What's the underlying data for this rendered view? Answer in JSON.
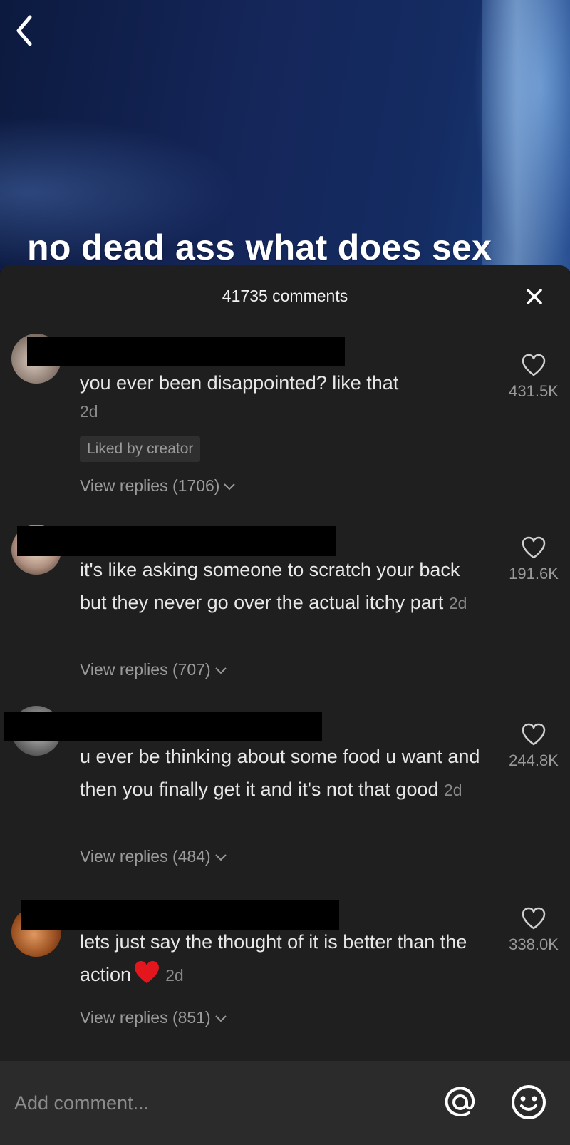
{
  "video": {
    "caption": "no dead ass what does sex"
  },
  "icons": {
    "back": "chevron-left-icon",
    "close": "close-icon",
    "like": "heart-outline-icon",
    "expand": "chevron-down-icon",
    "mention": "at-sign-icon",
    "emoji": "smiley-icon",
    "heart_emoji": "red-heart-emoji"
  },
  "colors": {
    "sheet_background": "#1f1f1f",
    "redaction": "#000000",
    "heart_emoji": "#e3161d"
  },
  "comments_sheet": {
    "count_label": "41735 comments",
    "comments": [
      {
        "text": "you ever been disappointed? like that",
        "time": "2d",
        "badge": "Liked by creator",
        "likes": "431.5K",
        "view_replies": "View replies (1706)"
      },
      {
        "text": "it's like asking someone to scratch your back but they never go over the actual itchy part",
        "time": "2d",
        "likes": "191.6K",
        "view_replies": "View replies (707)"
      },
      {
        "text": "u ever be thinking about some food u want and then you finally get it and it's not that good",
        "time": "2d",
        "likes": "244.8K",
        "view_replies": "View replies (484)"
      },
      {
        "text": "lets just say the thought of it is better than the action",
        "time": "2d",
        "likes": "338.0K",
        "view_replies": "View replies (851)"
      }
    ]
  },
  "composer": {
    "placeholder": "Add comment..."
  }
}
